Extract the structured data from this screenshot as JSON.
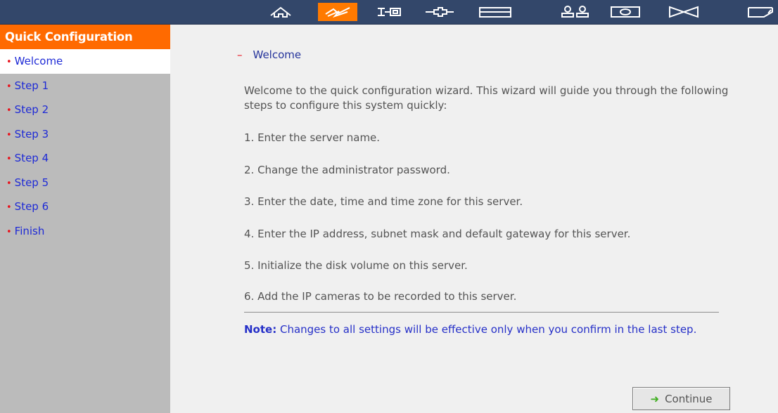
{
  "toolbar": {
    "icons": [
      {
        "name": "home-icon",
        "active": false
      },
      {
        "name": "quick-config-icon",
        "active": true
      },
      {
        "name": "system-settings-icon",
        "active": false
      },
      {
        "name": "network-icon",
        "active": false
      },
      {
        "name": "disk-icon",
        "active": false
      },
      {
        "name": "users-icon",
        "active": false
      },
      {
        "name": "camera-icon",
        "active": false
      },
      {
        "name": "connection-icon",
        "active": false
      },
      {
        "name": "tools-icon",
        "active": false
      }
    ],
    "accent_color": "#ff7a00",
    "bar_color": "#33476a"
  },
  "sidebar": {
    "title": "Quick Configuration",
    "items": [
      {
        "label": "Welcome",
        "current": true
      },
      {
        "label": "Step 1",
        "current": false
      },
      {
        "label": "Step 2",
        "current": false
      },
      {
        "label": "Step 3",
        "current": false
      },
      {
        "label": "Step 4",
        "current": false
      },
      {
        "label": "Step 5",
        "current": false
      },
      {
        "label": "Step 6",
        "current": false
      },
      {
        "label": "Finish",
        "current": false
      }
    ]
  },
  "main": {
    "heading": "Welcome",
    "intro": "Welcome to the quick configuration wizard. This wizard will guide you through the following steps to configure this system quickly:",
    "steps": [
      "1. Enter the server name.",
      "2. Change the administrator password.",
      "3. Enter the date, time and time zone for this server.",
      "4. Enter the IP address, subnet mask and default gateway for this server.",
      "5. Initialize the disk volume on this server.",
      "6. Add the IP cameras to be recorded to this server."
    ],
    "note_label": "Note:",
    "note_text": " Changes to all settings will be effective only when you confirm in the last step.",
    "continue_label": "Continue"
  }
}
